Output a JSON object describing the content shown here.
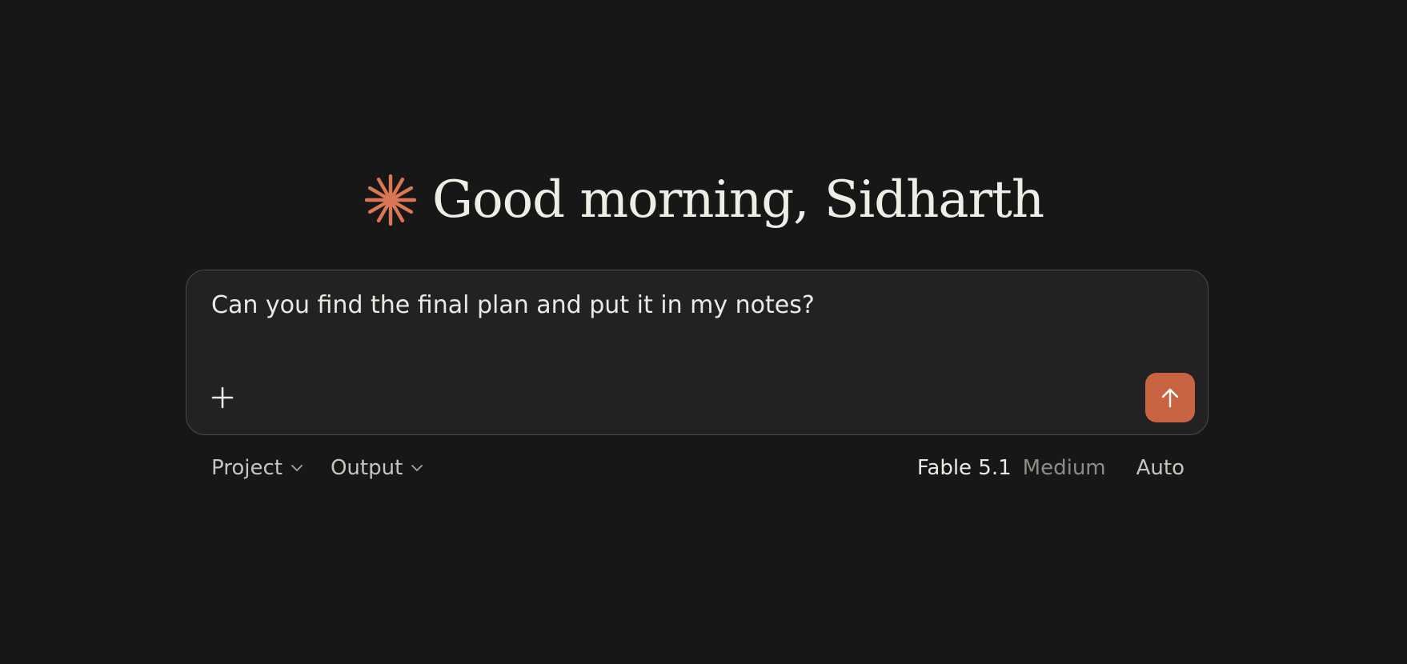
{
  "greeting": {
    "icon": "spark-icon",
    "text": "Good morning, Sidharth",
    "icon_color": "#d97757"
  },
  "composer": {
    "input_value": "Can you find the final plan and put it in my notes?",
    "attach_icon": "plus-icon",
    "send_icon": "arrow-up-icon",
    "send_color": "#c96442"
  },
  "toolbar": {
    "project_label": "Project",
    "output_label": "Output",
    "model_name": "Fable 5.1",
    "model_effort": "Medium",
    "mode_label": "Auto"
  }
}
